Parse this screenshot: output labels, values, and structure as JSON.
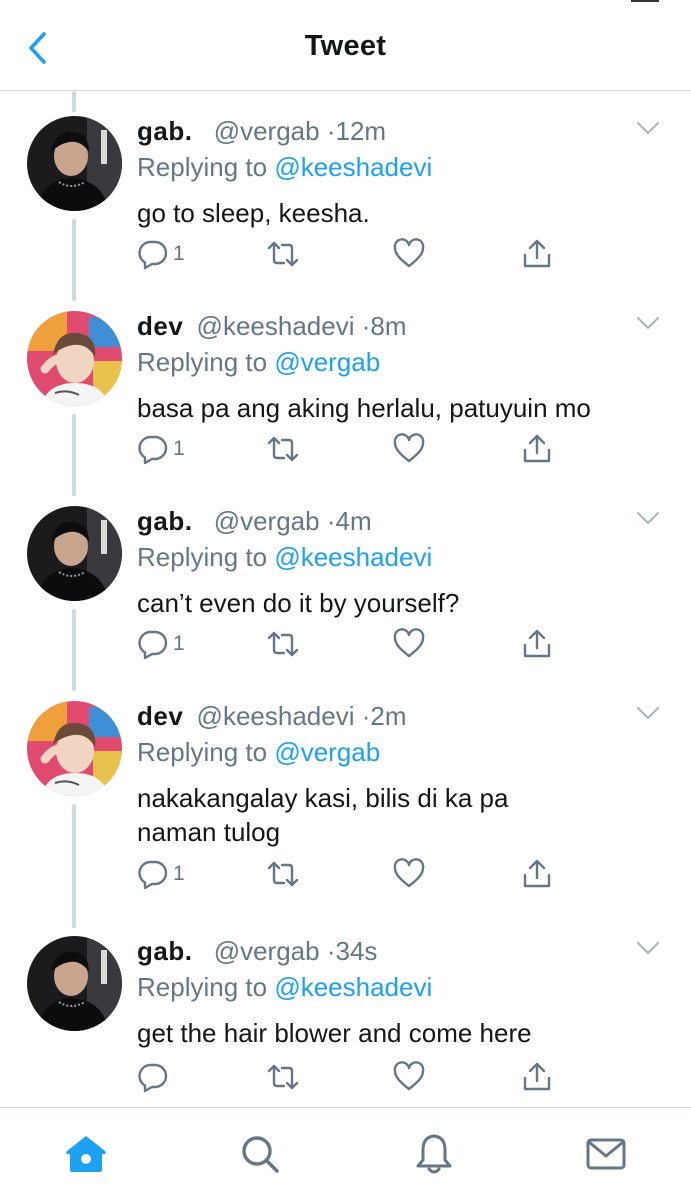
{
  "header": {
    "title": "Tweet",
    "back_icon": "chevron-left-icon",
    "accent": "#1da1f2"
  },
  "tweets": [
    {
      "name": "gab.",
      "handle": "@vergab",
      "separator": "·",
      "time": "12m",
      "replying_prefix": "Replying to ",
      "replying_to": "@keeshadevi",
      "text": "go to sleep, keesha.",
      "reply_count": "1",
      "avatar": "gab-avatar"
    },
    {
      "name": "dev",
      "handle": "@keeshadevi",
      "separator": "·",
      "time": "8m",
      "replying_prefix": "Replying to ",
      "replying_to": "@vergab",
      "text": "basa pa ang aking herlalu, patuyuin mo",
      "reply_count": "1",
      "avatar": "dev-avatar"
    },
    {
      "name": "gab.",
      "handle": "@vergab",
      "separator": "·",
      "time": "4m",
      "replying_prefix": "Replying to ",
      "replying_to": "@keeshadevi",
      "text": "can’t even do it by yourself?",
      "reply_count": "1",
      "avatar": "gab-avatar"
    },
    {
      "name": "dev",
      "handle": "@keeshadevi",
      "separator": "·",
      "time": "2m",
      "replying_prefix": "Replying to ",
      "replying_to": "@vergab",
      "text": "nakakangalay kasi, bilis di ka pa naman tulog",
      "reply_count": "1",
      "avatar": "dev-avatar"
    },
    {
      "name": "gab.",
      "handle": "@vergab",
      "separator": "·",
      "time": "34s",
      "replying_prefix": "Replying to ",
      "replying_to": "@keeshadevi",
      "text": "get the hair blower and come here",
      "reply_count": "",
      "avatar": "gab-avatar"
    }
  ],
  "tabbar": {
    "items": [
      "home-icon",
      "search-icon",
      "notifications-bell-icon",
      "messages-envelope-icon"
    ],
    "active": "home-icon"
  }
}
